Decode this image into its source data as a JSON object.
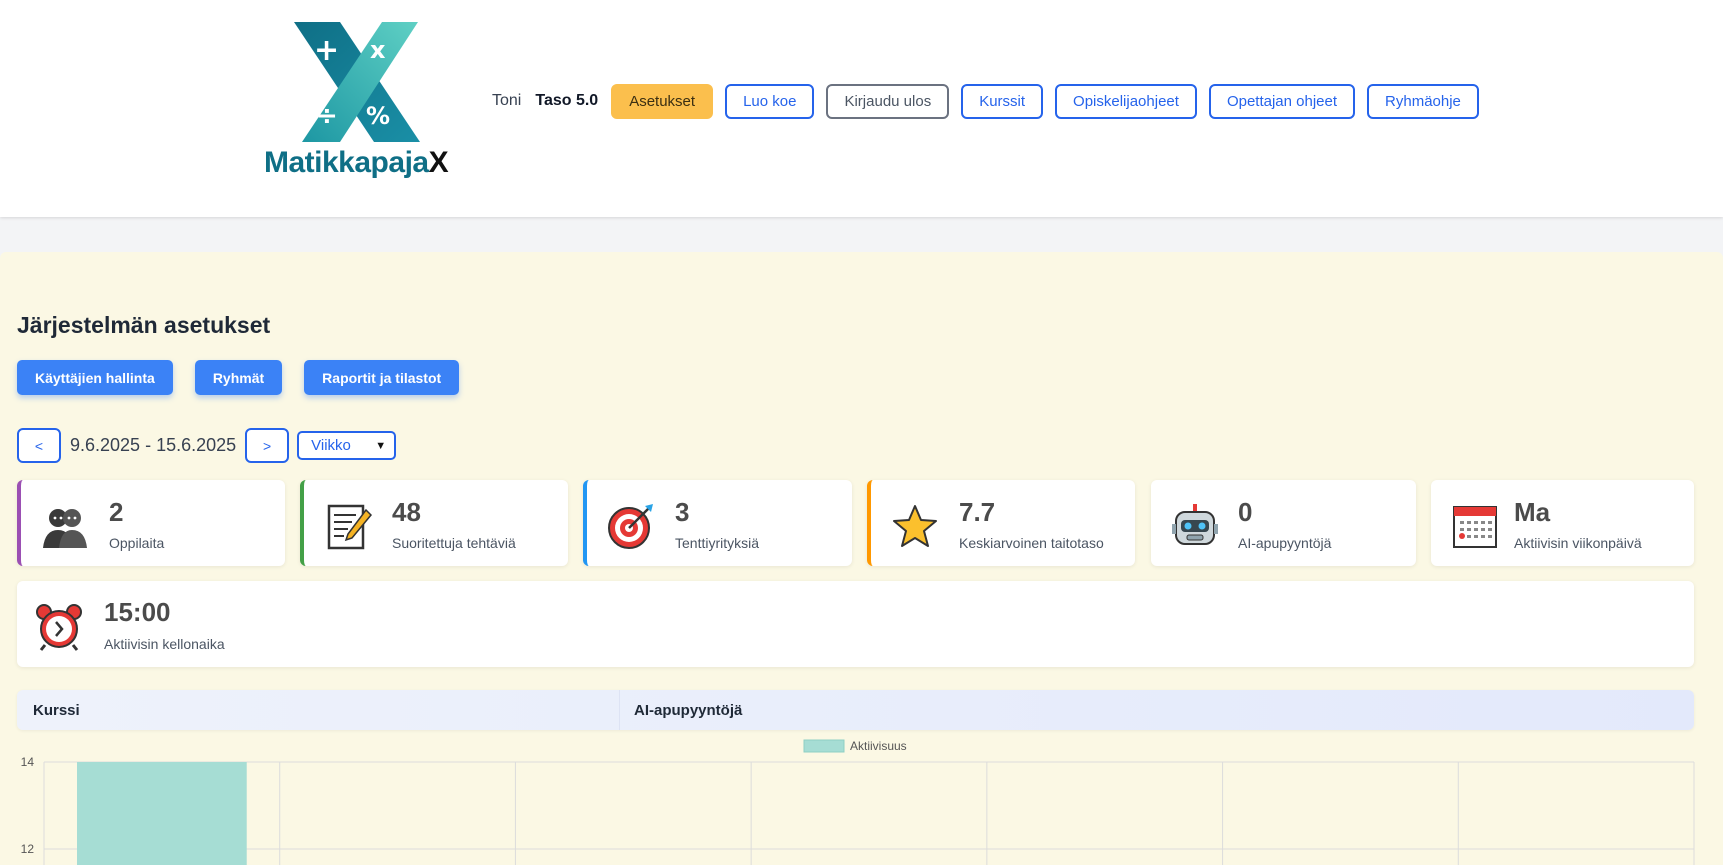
{
  "header": {
    "logo": {
      "text_main": "Matikkapaja",
      "text_accent": "X"
    },
    "user_name": "Toni",
    "user_level": "Taso 5.0",
    "nav": [
      {
        "label": "Asetukset",
        "style": "warn"
      },
      {
        "label": "Luo koe",
        "style": "primary"
      },
      {
        "label": "Kirjaudu ulos",
        "style": "gray"
      },
      {
        "label": "Kurssit",
        "style": "primary"
      },
      {
        "label": "Opiskelijaohjeet",
        "style": "primary"
      },
      {
        "label": "Opettajan ohjeet",
        "style": "primary"
      },
      {
        "label": "Ryhmäohje",
        "style": "primary"
      }
    ]
  },
  "main": {
    "title": "Järjestelmän asetukset",
    "admin_buttons": [
      "Käyttäjien hallinta",
      "Ryhmät",
      "Raportit ja tilastot"
    ],
    "date_nav": {
      "prev": "<",
      "range": "9.6.2025 - 15.6.2025",
      "next": ">",
      "period": "Viikko"
    },
    "stats": [
      {
        "value": "2",
        "label": "Oppilaita",
        "icon": "students-icon",
        "accent": "#9b4fb3"
      },
      {
        "value": "48",
        "label": "Suoritettuja tehtäviä",
        "icon": "memo-icon",
        "accent": "#43a047"
      },
      {
        "value": "3",
        "label": "Tenttiyrityksiä",
        "icon": "target-icon",
        "accent": "#2196f3"
      },
      {
        "value": "7.7",
        "label": "Keskiarvoinen taitotaso",
        "icon": "star-icon",
        "accent": "#ff9800"
      },
      {
        "value": "0",
        "label": "AI-apupyyntöjä",
        "icon": "robot-icon",
        "accent": ""
      },
      {
        "value": "Ma",
        "label": "Aktiivisin viikonpäivä",
        "icon": "calendar-icon",
        "accent": ""
      }
    ],
    "time_stat": {
      "value": "15:00",
      "label": "Aktiivisin kellonaika",
      "icon": "alarm-clock-icon"
    },
    "table_headers": {
      "course": "Kurssi",
      "ai": "AI-apupyyntöjä"
    }
  },
  "colors": {
    "primary": "#2563eb",
    "warn": "#fbbf4d",
    "bar": "#a6ddd4",
    "main_bg": "#fbf8e4"
  },
  "chart_data": {
    "type": "bar",
    "legend": [
      "Aktiivisuus"
    ],
    "categories": [
      "",
      "",
      "",
      "",
      "",
      "",
      ""
    ],
    "series": [
      {
        "name": "Aktiivisuus",
        "values": [
          14,
          0,
          0,
          0,
          0,
          0,
          0
        ]
      }
    ],
    "yticks": [
      14,
      12
    ],
    "ylim_visible": [
      11,
      14
    ],
    "grid": true,
    "legend_position": "top-center"
  }
}
